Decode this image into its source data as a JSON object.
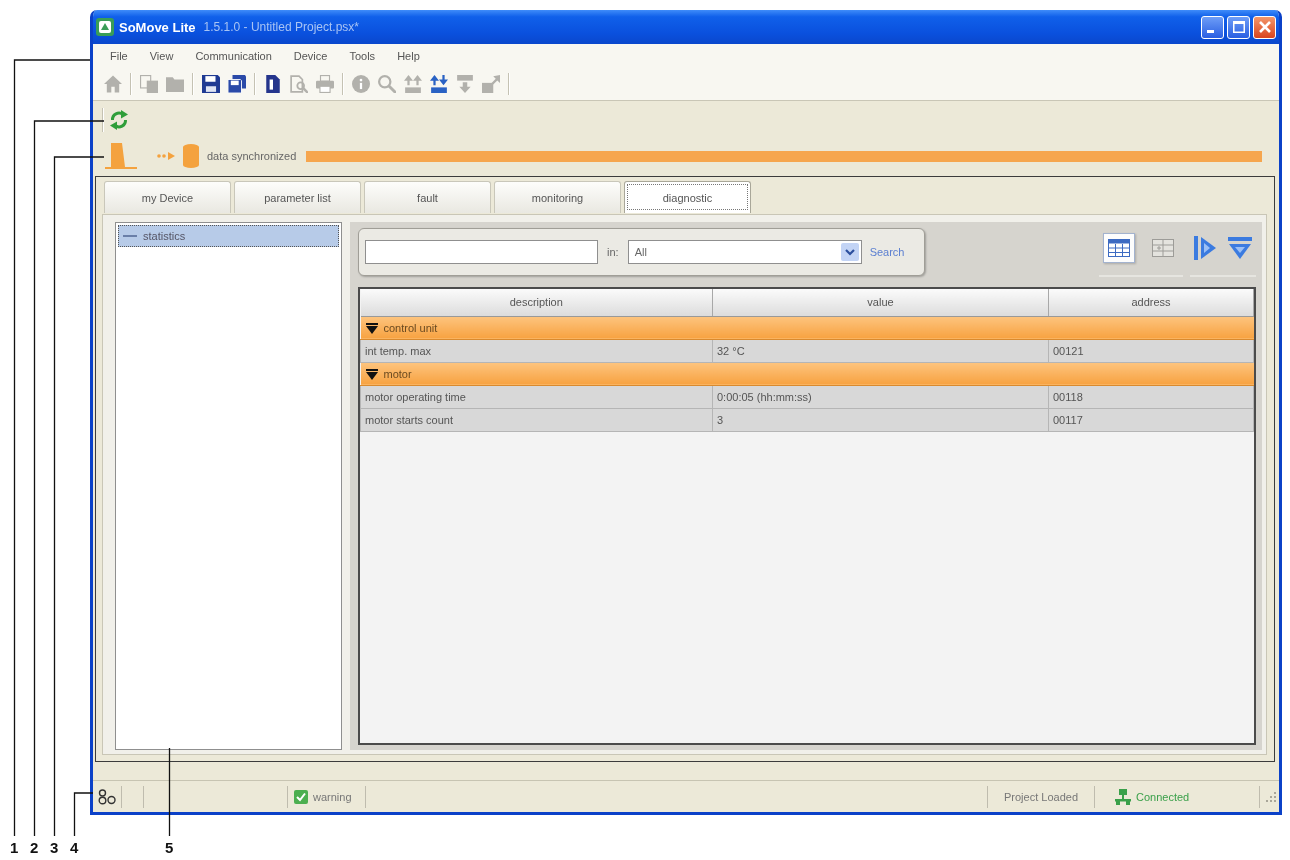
{
  "window": {
    "app_name": "SoMove Lite",
    "title": "1.5.1.0 - Untitled Project.psx*"
  },
  "menu": [
    "File",
    "View",
    "Communication",
    "Device",
    "Tools",
    "Help"
  ],
  "toolbar": [
    [
      {
        "kind": "home",
        "disabled": true
      }
    ],
    [
      {
        "kind": "copy",
        "disabled": true
      },
      {
        "kind": "open",
        "disabled": true
      }
    ],
    [
      {
        "kind": "save",
        "disabled": false
      },
      {
        "kind": "saveall",
        "disabled": false
      }
    ],
    [
      {
        "kind": "page",
        "disabled": false
      },
      {
        "kind": "preview",
        "disabled": true
      },
      {
        "kind": "print",
        "disabled": true
      }
    ],
    [
      {
        "kind": "info",
        "disabled": true
      },
      {
        "kind": "find",
        "disabled": true
      },
      {
        "kind": "upload",
        "disabled": true
      },
      {
        "kind": "transfer",
        "disabled": false
      },
      {
        "kind": "download",
        "disabled": true
      },
      {
        "kind": "export",
        "disabled": true
      }
    ]
  ],
  "sync": {
    "label": "data synchronized",
    "level": 1
  },
  "tabs": [
    {
      "label": "my Device",
      "selected": false
    },
    {
      "label": "parameter list",
      "selected": false
    },
    {
      "label": "fault",
      "selected": false
    },
    {
      "label": "monitoring",
      "selected": false
    },
    {
      "label": "diagnostic",
      "selected": true
    }
  ],
  "tree": [
    {
      "label": "statistics",
      "selected": true
    }
  ],
  "search": {
    "scope_label": "in:",
    "scope": "All",
    "button": "Search"
  },
  "views": [
    {
      "kind": "table",
      "selected": true
    },
    {
      "kind": "grid",
      "selected": false
    }
  ],
  "table": {
    "columns": [
      "description",
      "value",
      "address"
    ],
    "groups": [
      {
        "label": "control unit",
        "expanded": true,
        "rows": [
          [
            "int temp. max",
            "32 °C",
            "00121"
          ]
        ]
      },
      {
        "label": "motor",
        "expanded": true,
        "rows": [
          [
            "motor operating time",
            "0:00:05 (hh:mm:ss)",
            "00118"
          ],
          [
            "motor starts count",
            "3",
            "00117"
          ]
        ]
      }
    ]
  },
  "status_bar": {
    "warning": "warning",
    "project": "Project Loaded",
    "connection": "Connected"
  },
  "callouts": [
    "1",
    "2",
    "3",
    "4",
    "5"
  ]
}
